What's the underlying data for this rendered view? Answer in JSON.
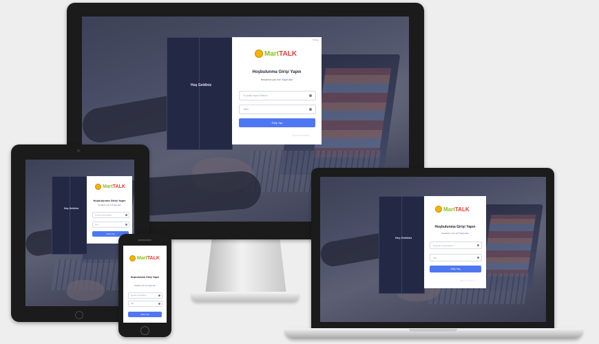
{
  "colors": {
    "page_background": "#eeeeee",
    "bezel": "#1b1b1c",
    "overlay": "#3d4157",
    "left_panel": "#232945",
    "primary_button": "#4f77f1",
    "logo_green": "#8bbf1f",
    "logo_red": "#e53935"
  },
  "login": {
    "brand_logo_text": "MartTALK",
    "brand_tagline": "",
    "title": "Hoşbulunma Girişi Yapın",
    "subtitle": "Hesabınız yok mu?",
    "subtitle_link": "Kayıt olun",
    "left_panel_label": "Hoş Geldiniz",
    "email_placeholder": "E-posta veya Kullanıcı",
    "password_placeholder": "Şifre",
    "submit_label": "Giriş Yap",
    "forgot_link": "Şifremi Unuttum",
    "language": "Türkçe"
  },
  "icons": {
    "email": "user-icon",
    "password": "lock-icon",
    "logo": "smiley-icon",
    "home_button": "home-button-icon"
  }
}
